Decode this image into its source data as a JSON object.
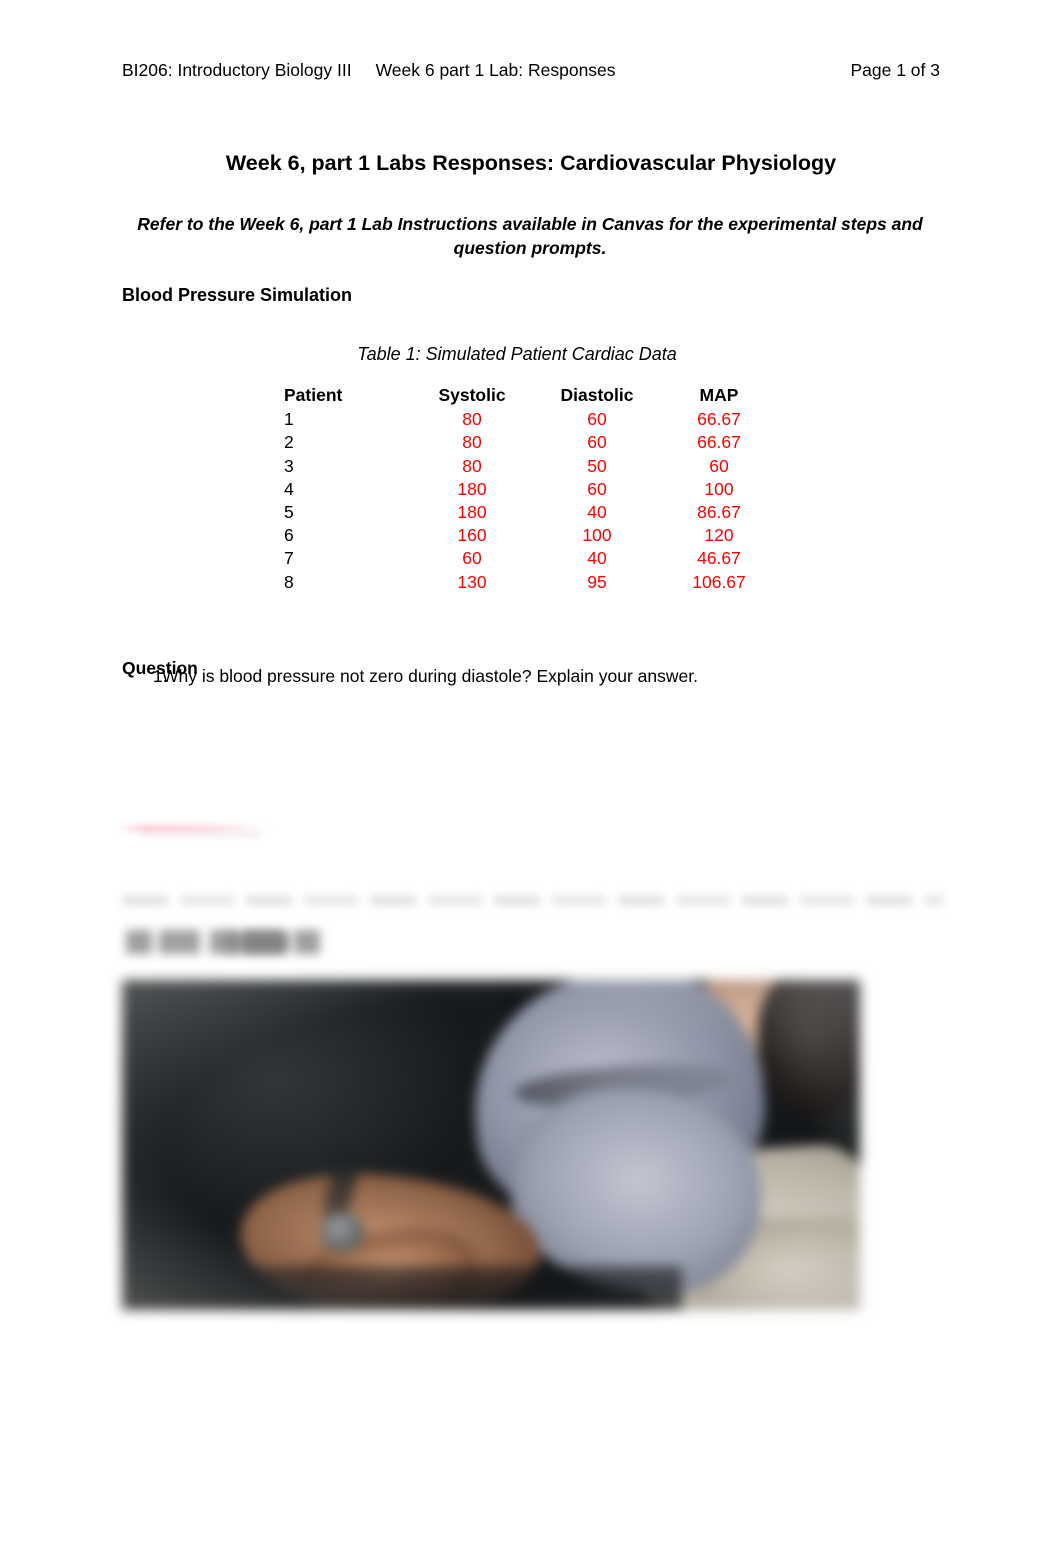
{
  "header": {
    "course": "BI206: Introductory Biology III",
    "lab": "Week 6 part 1 Lab: Responses",
    "page_number": "Page 1 of 3"
  },
  "title": "Week 6, part 1 Labs Responses: Cardiovascular Physiology",
  "subtitle": "Refer to the Week 6, part 1 Lab Instructions available in Canvas for the experimental steps and question prompts.",
  "section_heading": "Blood Pressure Simulation",
  "table": {
    "caption": "Table 1: Simulated Patient Cardiac Data",
    "columns": [
      "Patient",
      "Systolic",
      "Diastolic",
      "MAP"
    ],
    "value_color": "#ff0000",
    "rows": [
      {
        "patient": "1",
        "systolic": "80",
        "diastolic": "60",
        "map": "66.67"
      },
      {
        "patient": "2",
        "systolic": "80",
        "diastolic": "60",
        "map": "66.67"
      },
      {
        "patient": "3",
        "systolic": "80",
        "diastolic": "50",
        "map": "60"
      },
      {
        "patient": "4",
        "systolic": "180",
        "diastolic": "60",
        "map": "100"
      },
      {
        "patient": "5",
        "systolic": "180",
        "diastolic": "40",
        "map": "86.67"
      },
      {
        "patient": "6",
        "systolic": "160",
        "diastolic": "100",
        "map": "120"
      },
      {
        "patient": "7",
        "systolic": "60",
        "diastolic": "40",
        "map": "46.67"
      },
      {
        "patient": "8",
        "systolic": "130",
        "diastolic": "95",
        "map": "106.67"
      }
    ]
  },
  "question_section": {
    "heading": "Question",
    "items": [
      {
        "number": "1.",
        "text": "Why is blood pressure not zero during diastole? Explain your answer."
      }
    ]
  },
  "blurred_content": {
    "photo_alt": "blurred photograph of a person having blood pressure measured"
  }
}
